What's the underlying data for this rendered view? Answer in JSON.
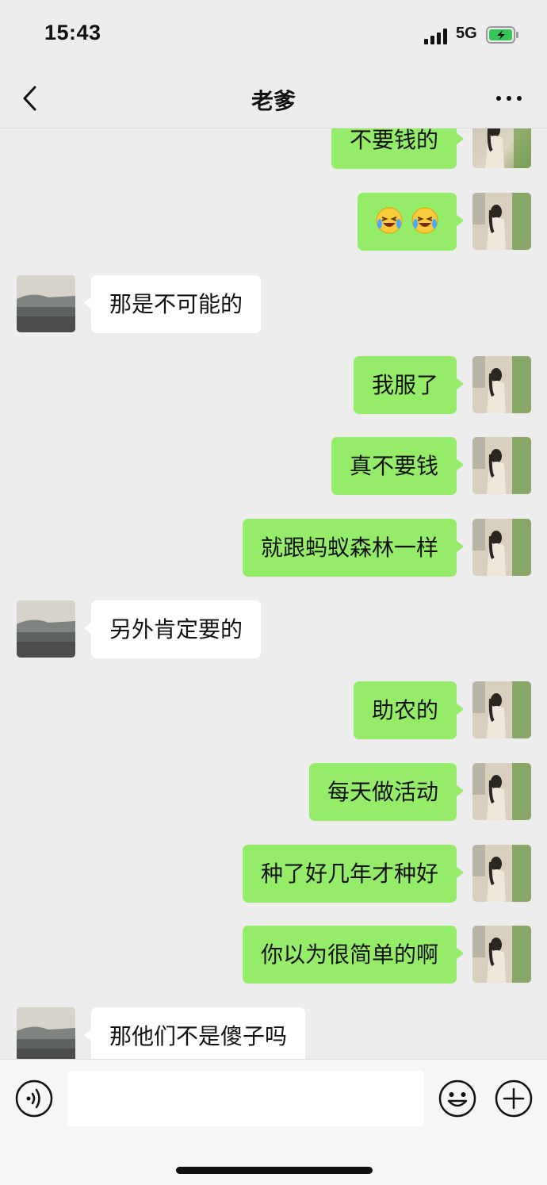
{
  "status_bar": {
    "time": "15:43",
    "network": "5G"
  },
  "header": {
    "title": "老爹"
  },
  "messages": [
    {
      "side": "out",
      "text": "不要钱的"
    },
    {
      "side": "out",
      "emoji": [
        "laughing-crying-face",
        "laughing-crying-face"
      ]
    },
    {
      "side": "in",
      "text": "那是不可能的"
    },
    {
      "side": "out",
      "text": "我服了"
    },
    {
      "side": "out",
      "text": "真不要钱"
    },
    {
      "side": "out",
      "text": "就跟蚂蚁森林一样"
    },
    {
      "side": "in",
      "text": "另外肯定要的"
    },
    {
      "side": "out",
      "text": "助农的"
    },
    {
      "side": "out",
      "text": "每天做活动"
    },
    {
      "side": "out",
      "text": "种了好几年才种好"
    },
    {
      "side": "out",
      "text": "你以为很简单的啊"
    },
    {
      "side": "in",
      "text": "那他们不是傻子吗"
    }
  ],
  "input_bar": {
    "value": "",
    "icons": [
      "voice-icon",
      "emoji-icon",
      "plus-icon"
    ]
  },
  "colors": {
    "outgoing_bubble": "#95ec69",
    "incoming_bubble": "#ffffff",
    "background": "#ededed"
  }
}
